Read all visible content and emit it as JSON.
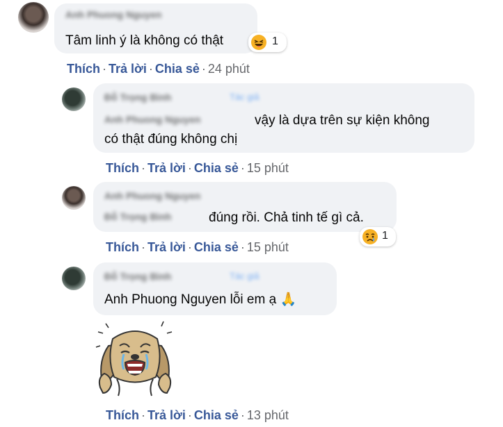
{
  "comments": [
    {
      "author": "Anh Phuong Nguyen",
      "text": "Tâm linh ý là không có thật",
      "reaction": {
        "icon": "haha-emoji-icon",
        "count": "1"
      },
      "actions": {
        "like": "Thích",
        "reply": "Trả lời",
        "share": "Chia sẻ",
        "time": "24 phút"
      }
    },
    {
      "author": "Đỗ Trọng Bình",
      "badge": "Tác giả",
      "mention": "Anh Phuong Nguyen",
      "text_line1": "vậy là dựa trên sự kiện không",
      "text_line2": "có thật đúng không chị",
      "actions": {
        "like": "Thích",
        "reply": "Trả lời",
        "share": "Chia sẻ",
        "time": "15 phút"
      }
    },
    {
      "author": "Anh Phuong Nguyen",
      "mention": "Đỗ Trọng Bình",
      "text": "đúng rồi. Chả tinh tế gì cả.",
      "reaction": {
        "icon": "sad-emoji-icon",
        "count": "1"
      },
      "actions": {
        "like": "Thích",
        "reply": "Trả lời",
        "share": "Chia sẻ",
        "time": "15 phút"
      }
    },
    {
      "author": "Đỗ Trọng Bình",
      "badge": "Tác giả",
      "text": "Anh Phuong Nguyen lỗi em ạ 🙏",
      "sticker": "crying-dog-sticker",
      "actions": {
        "like": "Thích",
        "reply": "Trả lời",
        "share": "Chia sẻ",
        "time": "13 phút"
      }
    }
  ],
  "colors": {
    "bubble": "#f0f2f5",
    "link": "#385898",
    "meta": "#65676b",
    "emoji": "#f7b125"
  }
}
